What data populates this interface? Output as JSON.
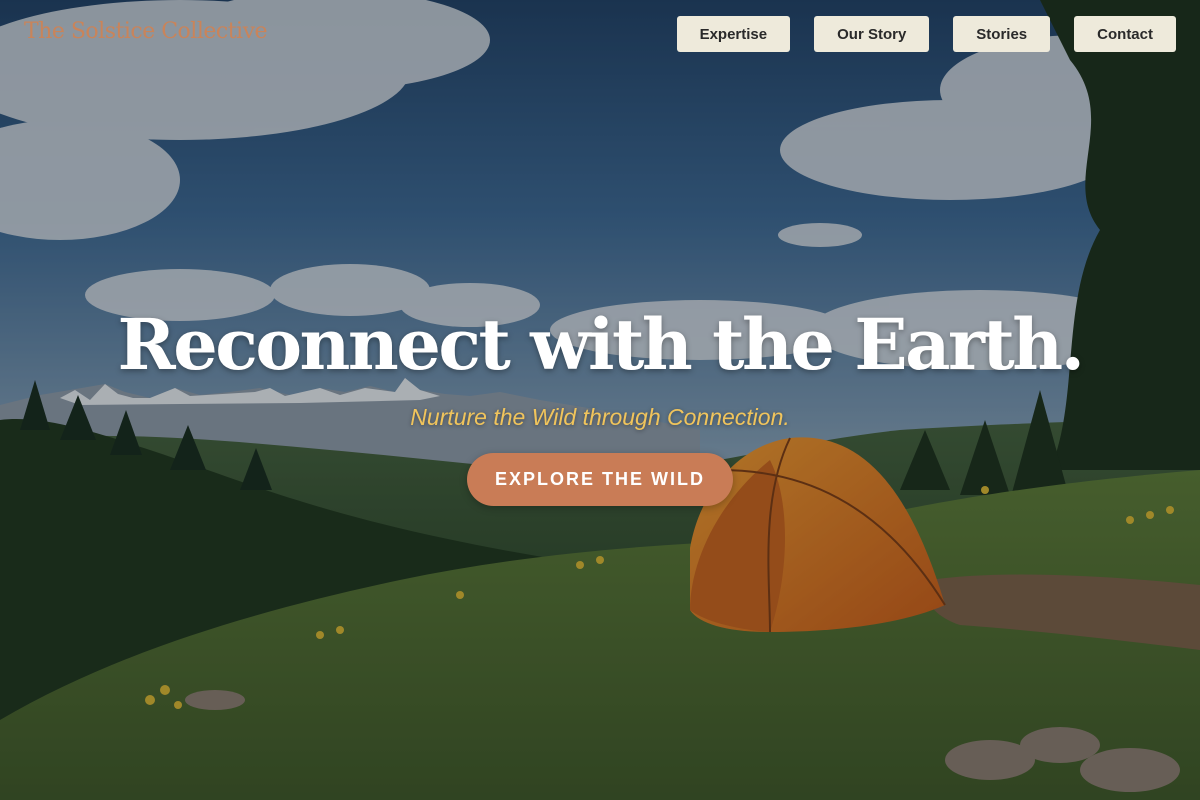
{
  "brand": {
    "name": "The Solstice Collective"
  },
  "nav": {
    "items": [
      {
        "label": "Expertise"
      },
      {
        "label": "Our Story"
      },
      {
        "label": "Stories"
      },
      {
        "label": "Contact"
      }
    ]
  },
  "hero": {
    "headline": "Reconnect with the Earth.",
    "subheadline": "Nurture the Wild through Connection.",
    "cta_label": "EXPLORE THE WILD",
    "background_icon": "mountain-meadow-tent-photo"
  },
  "colors": {
    "brand": "#c9845a",
    "nav_button_bg": "#eeeadb",
    "cta": "#c97c56",
    "subheadline": "#f0c45c",
    "tent": "#e07a1f",
    "sky": "#2f5a86"
  }
}
